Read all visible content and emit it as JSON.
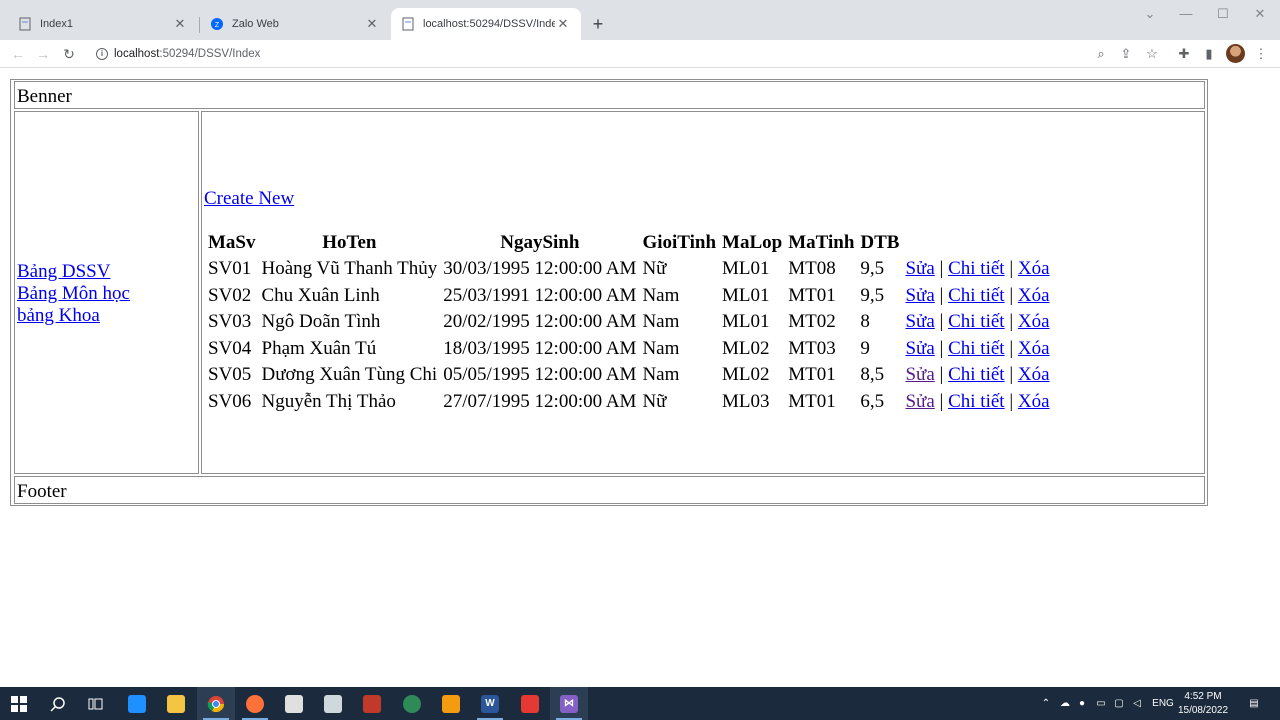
{
  "browser": {
    "tabs": [
      {
        "title": "Index1",
        "active": false
      },
      {
        "title": "Zalo Web",
        "active": false
      },
      {
        "title": "localhost:50294/DSSV/Index",
        "active": true
      }
    ],
    "address": {
      "host": "localhost",
      "path": ":50294/DSSV/Index"
    }
  },
  "page": {
    "banner": "Benner",
    "footer": "Footer",
    "sidebar_links": [
      "Bảng DSSV",
      "Bảng Môn học",
      "bảng Khoa"
    ],
    "create_new": "Create New",
    "table": {
      "headers": [
        "MaSv",
        "HoTen",
        "NgaySinh",
        "GioiTinh",
        "MaLop",
        "MaTinh",
        "DTB",
        ""
      ],
      "rows": [
        {
          "masv": "SV01",
          "hoten": "Hoàng Vũ Thanh Thủy",
          "ngaysinh": "30/03/1995 12:00:00 AM",
          "gioitinh": "Nữ",
          "malop": "ML01",
          "matinh": "MT08",
          "dtb": "9,5"
        },
        {
          "masv": "SV02",
          "hoten": "Chu Xuân Linh",
          "ngaysinh": "25/03/1991 12:00:00 AM",
          "gioitinh": "Nam",
          "malop": "ML01",
          "matinh": "MT01",
          "dtb": "9,5"
        },
        {
          "masv": "SV03",
          "hoten": "Ngô Doãn Tình",
          "ngaysinh": "20/02/1995 12:00:00 AM",
          "gioitinh": "Nam",
          "malop": "ML01",
          "matinh": "MT02",
          "dtb": "8"
        },
        {
          "masv": "SV04",
          "hoten": "Phạm Xuân Tú",
          "ngaysinh": "18/03/1995 12:00:00 AM",
          "gioitinh": "Nam",
          "malop": "ML02",
          "matinh": "MT03",
          "dtb": "9"
        },
        {
          "masv": "SV05",
          "hoten": "Dương Xuân Tùng Chi",
          "ngaysinh": "05/05/1995 12:00:00 AM",
          "gioitinh": "Nam",
          "malop": "ML02",
          "matinh": "MT01",
          "dtb": "8,5"
        },
        {
          "masv": "SV06",
          "hoten": "Nguyễn Thị Thảo",
          "ngaysinh": "27/07/1995 12:00:00 AM",
          "gioitinh": "Nữ",
          "malop": "ML03",
          "matinh": "MT01",
          "dtb": "6,5"
        }
      ],
      "actions": {
        "edit": "Sửa",
        "details": "Chi tiết",
        "delete": "Xóa",
        "separator": "|"
      }
    }
  },
  "taskbar": {
    "language": "ENG",
    "time": "4:52 PM",
    "date": "15/08/2022"
  },
  "colors": {
    "link": "#0000ee",
    "link_visited": "#551a8b",
    "taskbar": "#1b2a3c",
    "tabbar": "#dee1e6"
  }
}
